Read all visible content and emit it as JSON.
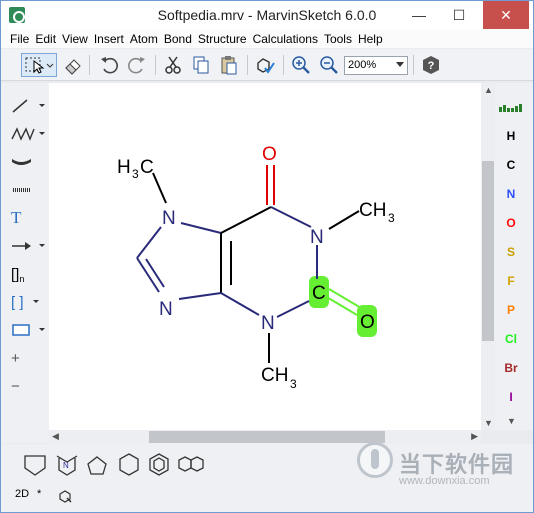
{
  "window": {
    "title": "Softpedia.mrv - MarvinSketch 6.0.0",
    "min_glyph": "—",
    "max_glyph": "☐",
    "close_glyph": "✕"
  },
  "menu": [
    "File",
    "Edit",
    "View",
    "Insert",
    "Atom",
    "Bond",
    "Structure",
    "Calculations",
    "Tools",
    "Help"
  ],
  "toolbar": {
    "zoom_value": "200%",
    "icons": [
      "select-icon",
      "eraser-icon",
      "undo-icon",
      "redo-icon",
      "cut-icon",
      "copy-icon",
      "paste-icon",
      "clean-icon",
      "zoom-in-icon",
      "zoom-out-icon",
      "help-icon"
    ]
  },
  "left_tools": {
    "text_tool": "T",
    "bracket_n": "[]",
    "bracket_n_sub": "n",
    "bracket": "[ ]",
    "plus": "+",
    "minus": "−"
  },
  "atoms": [
    {
      "symbol": "H",
      "color": "#000000"
    },
    {
      "symbol": "C",
      "color": "#000000"
    },
    {
      "symbol": "N",
      "color": "#3050f8"
    },
    {
      "symbol": "O",
      "color": "#ff0d0d"
    },
    {
      "symbol": "S",
      "color": "#c8a000"
    },
    {
      "symbol": "F",
      "color": "#d2a000"
    },
    {
      "symbol": "P",
      "color": "#ff8000"
    },
    {
      "symbol": "Cl",
      "color": "#1ff01f"
    },
    {
      "symbol": "Br",
      "color": "#a62929"
    },
    {
      "symbol": "I",
      "color": "#940094"
    }
  ],
  "molecule": {
    "labels": {
      "methyl_top_h": "H",
      "methyl_top_sub": "3",
      "methyl_top_c": "C",
      "o_top": "O",
      "n7": "N",
      "n1": "N",
      "ch3_right": "CH",
      "ch3_right_sub": "3",
      "n9": "N",
      "n3": "N",
      "c2": "C",
      "o2": "O",
      "ch3_bottom": "CH",
      "ch3_bottom_sub": "3"
    },
    "colors": {
      "carbon": "#000000",
      "nitrogen": "#2a2a7a",
      "oxygen": "#e00000",
      "highlight": "#66ee33"
    }
  },
  "status": {
    "mode": "2D",
    "star": "*"
  },
  "watermark": {
    "title": "当下软件园",
    "url": "www.downxia.com"
  }
}
